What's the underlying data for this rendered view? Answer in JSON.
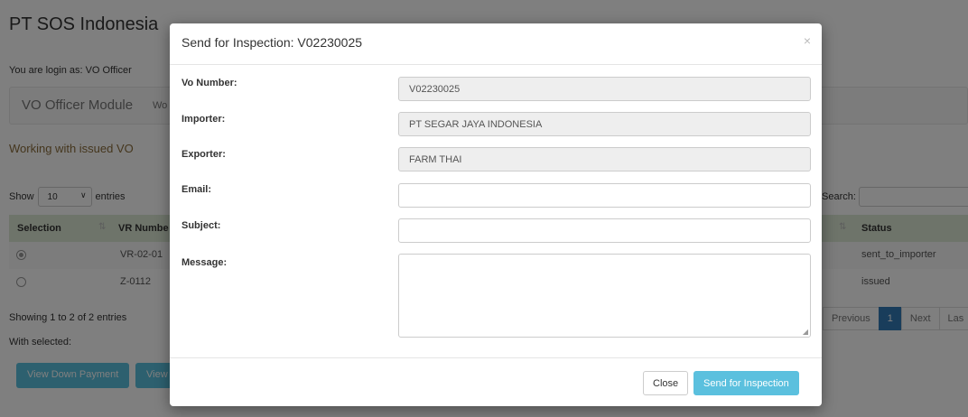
{
  "app": {
    "title": "PT SOS Indonesia",
    "login_text": "You are login as: VO Officer"
  },
  "nav": {
    "brand": "VO Officer Module",
    "link_partial": "Wo"
  },
  "working_text": "Working with issued VO",
  "table_controls": {
    "show_label": "Show",
    "length_value": "10",
    "entries_label": "entries",
    "search_label": "Search:"
  },
  "table": {
    "headers": {
      "selection": "Selection",
      "vr_number": "VR Numbe",
      "status": "Status"
    },
    "rows": [
      {
        "vr": "VR-02-01",
        "status": "sent_to_importer",
        "selected": true
      },
      {
        "vr": "Z-0112",
        "status": "issued",
        "selected": false
      }
    ],
    "info": "Showing 1 to 2 of 2 entries",
    "with_selected": "With selected:"
  },
  "pagination": {
    "previous": "Previous",
    "current": "1",
    "next": "Next",
    "last_partial": "Las"
  },
  "bg_buttons": {
    "down_payment": "View Down Payment",
    "view_partial": "View"
  },
  "modal": {
    "title": "Send for Inspection: V02230025",
    "close_glyph": "×",
    "fields": {
      "vo_number": {
        "label": "Vo Number:",
        "value": "V02230025"
      },
      "importer": {
        "label": "Importer:",
        "value": "PT SEGAR JAYA INDONESIA"
      },
      "exporter": {
        "label": "Exporter:",
        "value": "FARM THAI"
      },
      "email": {
        "label": "Email:",
        "value": ""
      },
      "subject": {
        "label": "Subject:",
        "value": ""
      },
      "message": {
        "label": "Message:",
        "value": ""
      }
    },
    "buttons": {
      "close": "Close",
      "send": "Send for Inspection"
    }
  }
}
